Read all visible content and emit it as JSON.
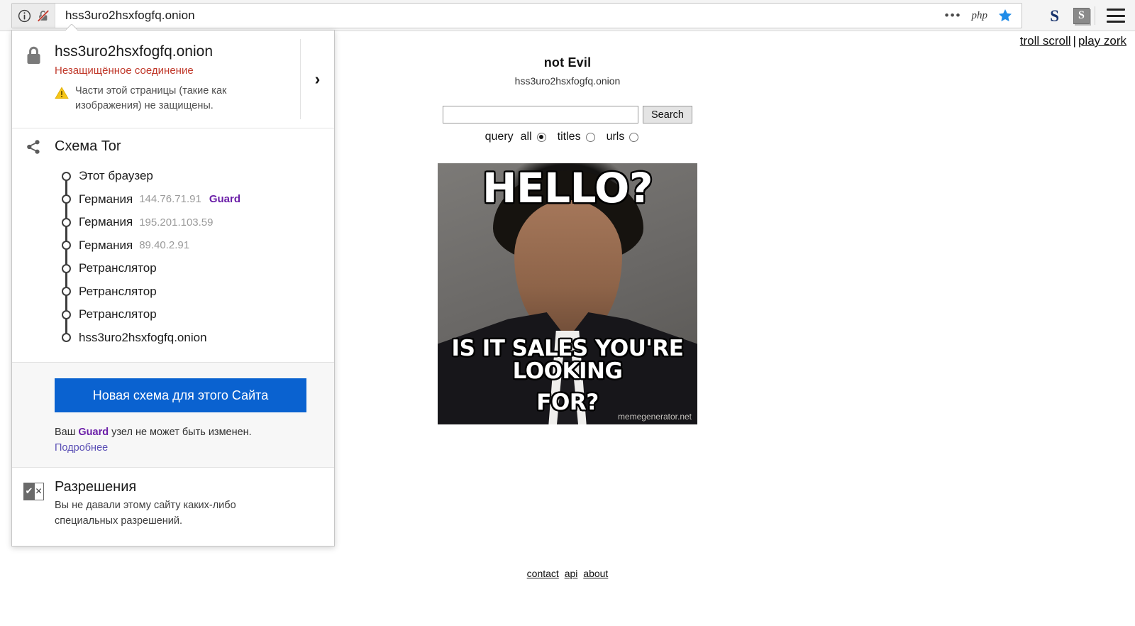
{
  "browser": {
    "url": "hss3uro2hsxfogfq.onion",
    "identity_icons": [
      "info-circle-icon",
      "broken-lock-icon"
    ],
    "urlbar_right_icons": [
      "more-dots-icon",
      "php-icon",
      "bookmark-star-icon"
    ],
    "php_label": "php",
    "extension_icons": [
      "s-blue-extension-icon",
      "s-grey-extension-icon"
    ],
    "ext_blue_label": "S",
    "ext_grey_label": "S",
    "menu_icon": "hamburger-menu-icon"
  },
  "popup": {
    "security": {
      "host": "hss3uro2hsxfogfq.onion",
      "status": "Незащищённое соединение",
      "warning": "Части этой страницы (такие как изображения) не защищены.",
      "expand_chevron": "›",
      "lock_icon": "lock-icon",
      "warning_icon": "warning-triangle-icon",
      "status_color": "#c0392b"
    },
    "tor": {
      "title": "Схема Tor",
      "icon": "share-network-icon",
      "nodes": [
        {
          "label": "Этот браузер",
          "ip": "",
          "tag": ""
        },
        {
          "label": "Германия",
          "ip": "144.76.71.91",
          "tag": "Guard"
        },
        {
          "label": "Германия",
          "ip": "195.201.103.59",
          "tag": ""
        },
        {
          "label": "Германия",
          "ip": "89.40.2.91",
          "tag": ""
        },
        {
          "label": "Ретранслятор",
          "ip": "",
          "tag": ""
        },
        {
          "label": "Ретранслятор",
          "ip": "",
          "tag": ""
        },
        {
          "label": "Ретранслятор",
          "ip": "",
          "tag": ""
        },
        {
          "label": "hss3uro2hsxfogfq.onion",
          "ip": "",
          "tag": ""
        }
      ],
      "guard_color": "#6b1fa8"
    },
    "new_circuit": {
      "button_label": "Новая схема для этого Сайта",
      "button_color": "#0a62d0",
      "note_prefix": "Ваш ",
      "note_bold": "Guard",
      "note_suffix": " узел не может быть изменен.",
      "learn_more": "Подробнее"
    },
    "permissions": {
      "title": "Разрешения",
      "text": "Вы не давали этому сайту каких-либо специальных разрешений.",
      "icon": "permissions-checkbox-icon",
      "icon_check": "✔",
      "icon_cross": "✕"
    }
  },
  "page": {
    "top_links": [
      {
        "label": "troll scroll"
      },
      {
        "label": "play zork"
      }
    ],
    "top_links_separator": "|",
    "title": "not Evil",
    "host": "hss3uro2hsxfogfq.onion",
    "search": {
      "value": "",
      "placeholder": "",
      "button_label": "Search",
      "query_label": "query",
      "options": [
        {
          "label": "all",
          "checked": true
        },
        {
          "label": "titles",
          "checked": false
        },
        {
          "label": "urls",
          "checked": false
        }
      ]
    },
    "meme": {
      "top_text": "HELLO?",
      "bottom_text_line1": "IS IT SALES YOU'RE LOOKING",
      "bottom_text_line2": "FOR?",
      "watermark": "memegenerator.net"
    },
    "footer_links": [
      {
        "label": "contact"
      },
      {
        "label": "api"
      },
      {
        "label": "about"
      }
    ]
  }
}
